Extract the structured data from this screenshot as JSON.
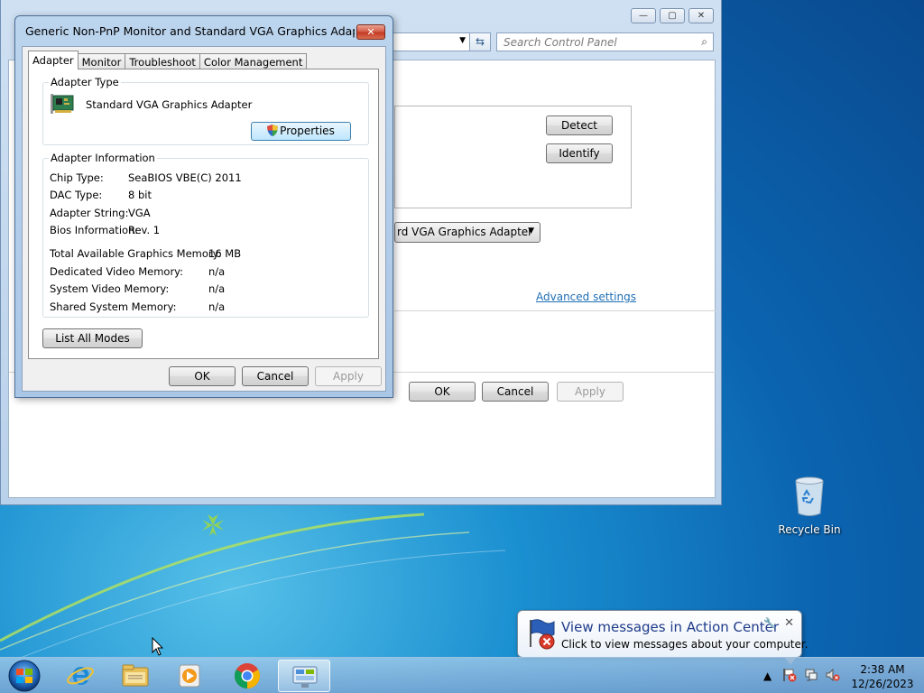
{
  "background_window": {
    "search_placeholder": "Search Control Panel",
    "buttons": {
      "detect": "Detect",
      "identify": "Identify",
      "ok": "OK",
      "cancel": "Cancel",
      "apply": "Apply"
    },
    "adapter_dropdown": "rd VGA Graphics Adapter",
    "advanced_link": "Advanced settings",
    "caption": {
      "minimize": "—",
      "maximize": "▢",
      "close": "✕"
    }
  },
  "dialog": {
    "title": "Generic Non-PnP Monitor and Standard VGA Graphics Adapter Pro...",
    "close_label": "✕",
    "tabs": [
      "Adapter",
      "Monitor",
      "Troubleshoot",
      "Color Management"
    ],
    "adapter_type": {
      "group_label": "Adapter Type",
      "name": "Standard VGA Graphics Adapter",
      "properties_button": "Properties"
    },
    "adapter_information": {
      "group_label": "Adapter Information",
      "chip_type_label": "Chip Type:",
      "chip_type_value": "SeaBIOS VBE(C) 2011",
      "dac_type_label": "DAC Type:",
      "dac_type_value": "8 bit",
      "adapter_string_label": "Adapter String:",
      "adapter_string_value": "VGA",
      "bios_label": "Bios Information:",
      "bios_value": "Rev. 1",
      "total_mem_label": "Total Available Graphics Memory:",
      "total_mem_value": "16 MB",
      "dedicated_label": "Dedicated Video Memory:",
      "dedicated_value": "n/a",
      "system_video_label": "System Video Memory:",
      "system_video_value": "n/a",
      "shared_label": "Shared System Memory:",
      "shared_value": "n/a"
    },
    "list_all_modes_button": "List All Modes",
    "buttons": {
      "ok": "OK",
      "cancel": "Cancel",
      "apply": "Apply"
    }
  },
  "desktop": {
    "recycle_bin_label": "Recycle Bin"
  },
  "notification": {
    "title": "View messages in Action Center",
    "text": "Click to view messages about your computer.",
    "close": "✕"
  },
  "taskbar": {
    "time": "2:38 AM",
    "date": "12/26/2023",
    "pinned": [
      "internet-explorer",
      "file-explorer",
      "media-player",
      "chrome",
      "control-panel"
    ]
  }
}
